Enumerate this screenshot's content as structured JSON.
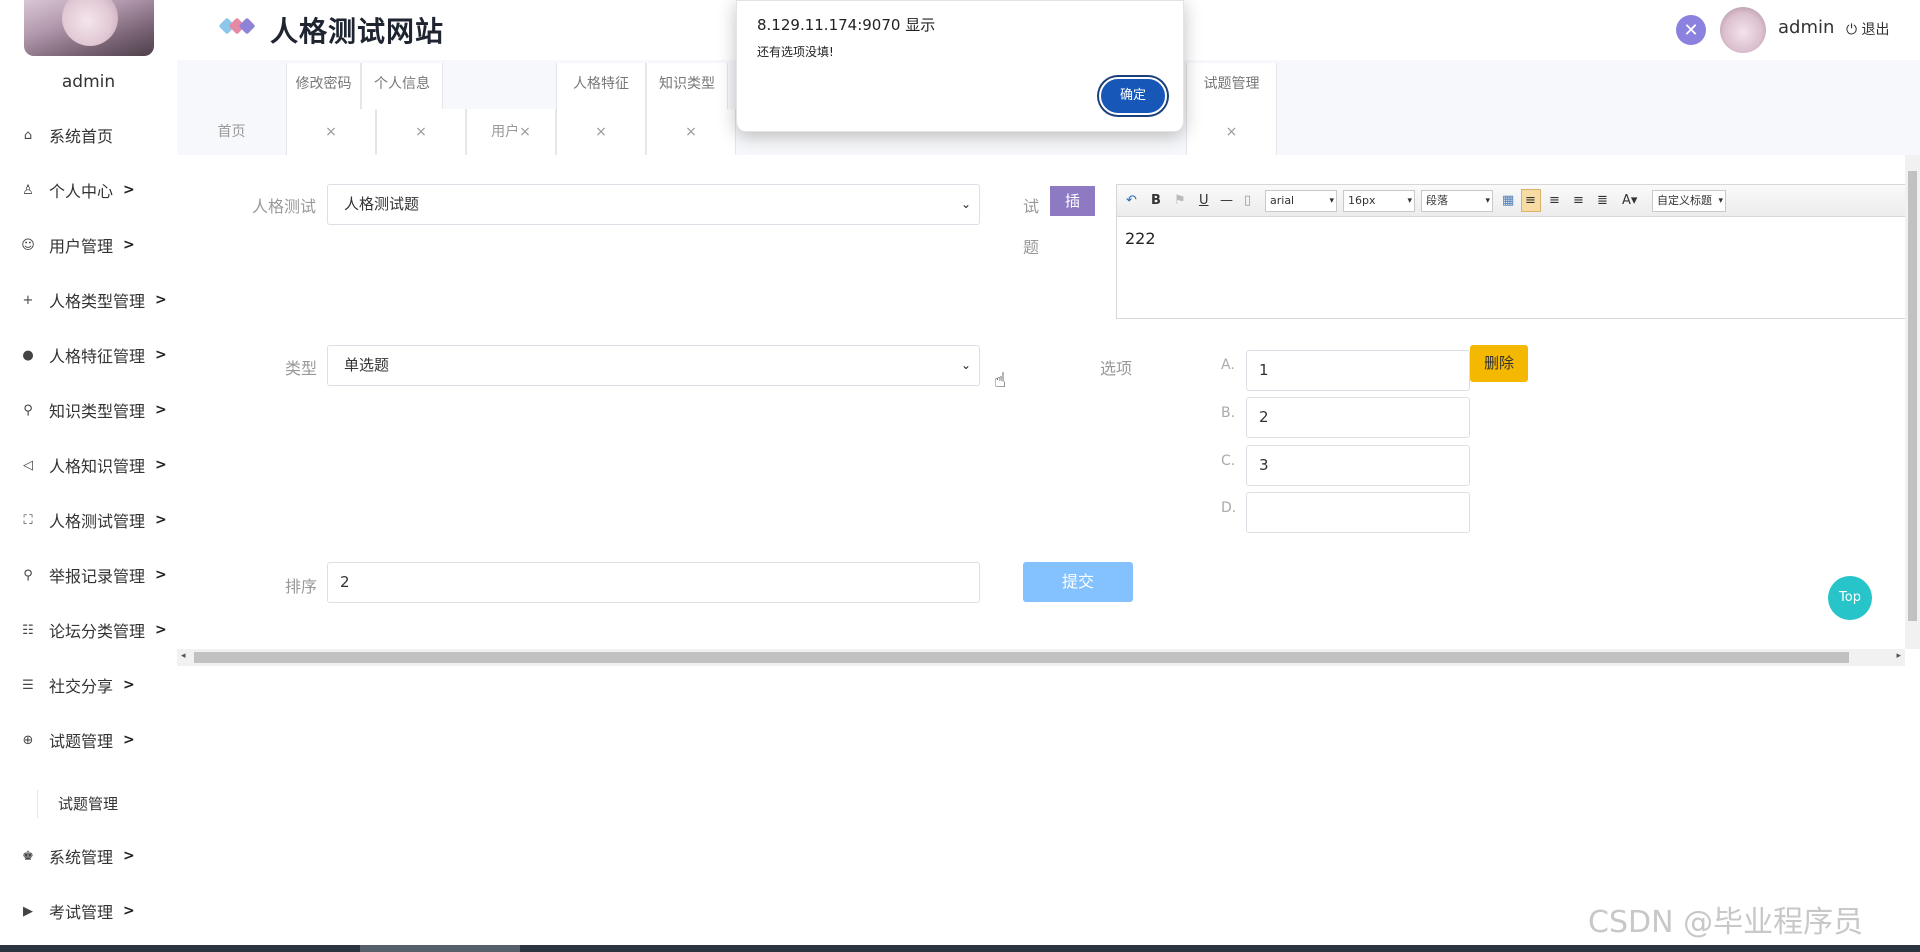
{
  "app": {
    "title": "人格测试网站",
    "user": "admin",
    "logout": "退出"
  },
  "sidebar": {
    "user": "admin",
    "items": [
      {
        "label": "系统首页",
        "icon": "home-icon",
        "chev": ""
      },
      {
        "label": "个人中心",
        "icon": "user-icon",
        "chev": ">"
      },
      {
        "label": "用户管理",
        "icon": "smile-icon",
        "chev": ">"
      },
      {
        "label": "人格类型管理",
        "icon": "plus-icon",
        "chev": ">"
      },
      {
        "label": "人格特征管理",
        "icon": "person-filled-icon",
        "chev": ">"
      },
      {
        "label": "知识类型管理",
        "icon": "key-icon",
        "chev": ">"
      },
      {
        "label": "人格知识管理",
        "icon": "speaker-icon",
        "chev": ">"
      },
      {
        "label": "人格测试管理",
        "icon": "scan-icon",
        "chev": ">"
      },
      {
        "label": "举报记录管理",
        "icon": "search-icon",
        "chev": ">"
      },
      {
        "label": "论坛分类管理",
        "icon": "grid-list-icon",
        "chev": ">"
      },
      {
        "label": "社交分享",
        "icon": "list-icon",
        "chev": ">"
      },
      {
        "label": "试题管理",
        "icon": "zoom-icon",
        "chev": ">"
      },
      {
        "label": "系统管理",
        "icon": "users-icon",
        "chev": ">"
      },
      {
        "label": "考试管理",
        "icon": "play-icon",
        "chev": ">"
      }
    ],
    "sub_item": "试题管理"
  },
  "tabs": {
    "top": [
      "修改密码",
      "个人信息",
      "人格特征",
      "知识类型",
      "试题管理"
    ],
    "bottom": [
      "首页",
      "×",
      "×",
      "用户×",
      "×",
      "×",
      "×"
    ]
  },
  "form": {
    "test_label": "人格测试",
    "test_value": "人格测试题",
    "question_label_1": "试",
    "question_label_2": "题",
    "insert_button": "插",
    "type_label": "类型",
    "type_value": "单选题",
    "options_label": "选项",
    "options": [
      {
        "letter": "A.",
        "value": "1"
      },
      {
        "letter": "B.",
        "value": "2"
      },
      {
        "letter": "C.",
        "value": "3"
      },
      {
        "letter": "D.",
        "value": ""
      }
    ],
    "delete_button": "删除",
    "order_label": "排序",
    "order_value": "2",
    "submit_button": "提交"
  },
  "editor": {
    "font": "arial",
    "size": "16px",
    "paragraph": "段落",
    "custom_title": "自定义标题",
    "content": "222"
  },
  "dialog": {
    "title": "8.129.11.174:9070 显示",
    "message": "还有选项没填!",
    "ok": "确定"
  },
  "top_button": "Top",
  "watermark": "CSDN @毕业程序员",
  "colors": {
    "accent": "#8e79c3",
    "submit": "#84c1ff",
    "delete": "#f5b800",
    "dialog_ok": "#1657b8",
    "top": "#27c4c9"
  }
}
